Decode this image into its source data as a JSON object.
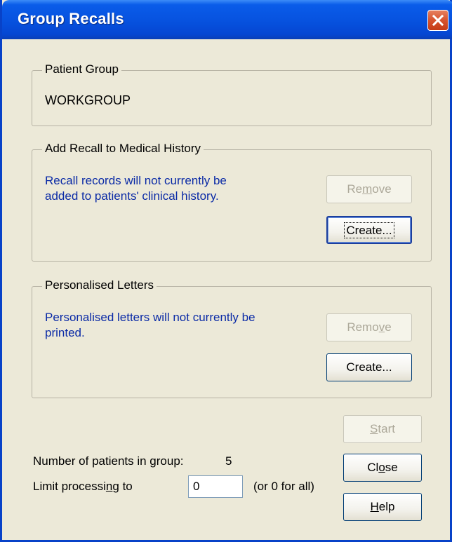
{
  "window": {
    "title": "Group Recalls"
  },
  "patient_group": {
    "legend": "Patient Group",
    "value": "WORKGROUP"
  },
  "recall_section": {
    "legend": "Add Recall to Medical History",
    "message_line1": "Recall records will not currently be",
    "message_line2": "added to patients' clinical history.",
    "remove_pre": "Re",
    "remove_ul": "m",
    "remove_post": "ove",
    "create_label": "Create..."
  },
  "letters_section": {
    "legend": "Personalised Letters",
    "message_line1": "Personalised letters will not currently be",
    "message_line2": "printed.",
    "remove_pre": "Remo",
    "remove_ul": "v",
    "remove_post": "e",
    "create_label": "Create..."
  },
  "footer": {
    "count_label": "Number of patients in group:",
    "count_value": "5",
    "limit_pre": "Limit processi",
    "limit_ul": "n",
    "limit_post": "g to",
    "limit_value": "0",
    "limit_hint": "(or 0 for all)"
  },
  "buttons": {
    "start_ul": "S",
    "start_post": "tart",
    "close_pre": "Cl",
    "close_ul": "o",
    "close_post": "se",
    "help_ul": "H",
    "help_post": "elp"
  },
  "colors": {
    "titlebar": "#0753e0",
    "info_text": "#0a2aa6",
    "close_button": "#d6532e",
    "dialog_bg": "#ece9d8"
  },
  "icons": {
    "close": "close-x-icon"
  }
}
